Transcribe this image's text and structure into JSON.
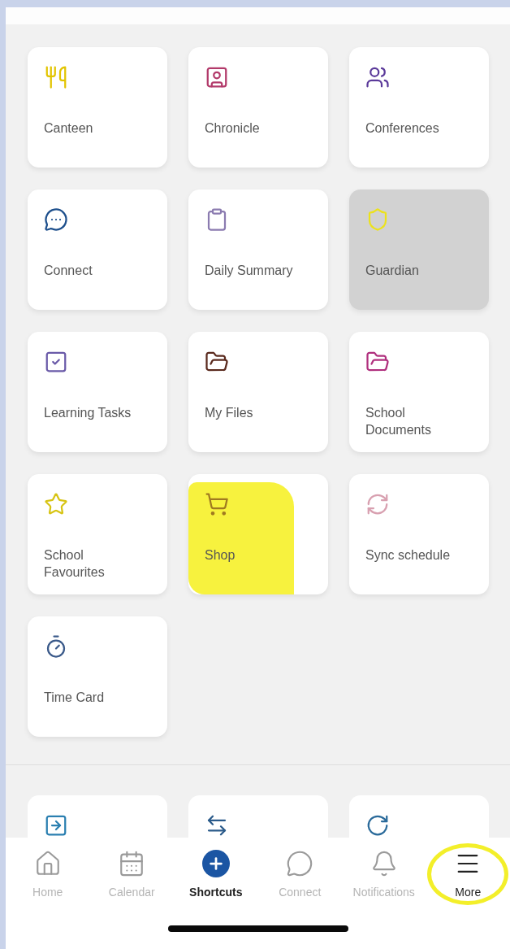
{
  "tiles": [
    {
      "label": "Canteen",
      "selected": false,
      "marked": false
    },
    {
      "label": "Chronicle",
      "selected": false,
      "marked": false
    },
    {
      "label": "Conferences",
      "selected": false,
      "marked": false
    },
    {
      "label": "Connect",
      "selected": false,
      "marked": false
    },
    {
      "label": "Daily Summary",
      "selected": false,
      "marked": false
    },
    {
      "label": "Guardian",
      "selected": true,
      "marked": false
    },
    {
      "label": "Learning Tasks",
      "selected": false,
      "marked": false
    },
    {
      "label": "My Files",
      "selected": false,
      "marked": false
    },
    {
      "label": "School Documents",
      "selected": false,
      "marked": false
    },
    {
      "label": "School Favourites",
      "selected": false,
      "marked": false
    },
    {
      "label": "Shop",
      "selected": false,
      "marked": true
    },
    {
      "label": "Sync schedule",
      "selected": false,
      "marked": false
    },
    {
      "label": "Time Card",
      "selected": false,
      "marked": false
    }
  ],
  "tab_bar": [
    {
      "label": "Home",
      "selected": false,
      "marked": false
    },
    {
      "label": "Calendar",
      "selected": false,
      "marked": false
    },
    {
      "label": "Shortcuts",
      "selected": true,
      "marked": false
    },
    {
      "label": "Connect",
      "selected": false,
      "marked": false
    },
    {
      "label": "Notifications",
      "selected": false,
      "marked": false
    },
    {
      "label": "More",
      "selected": false,
      "marked": true
    }
  ]
}
